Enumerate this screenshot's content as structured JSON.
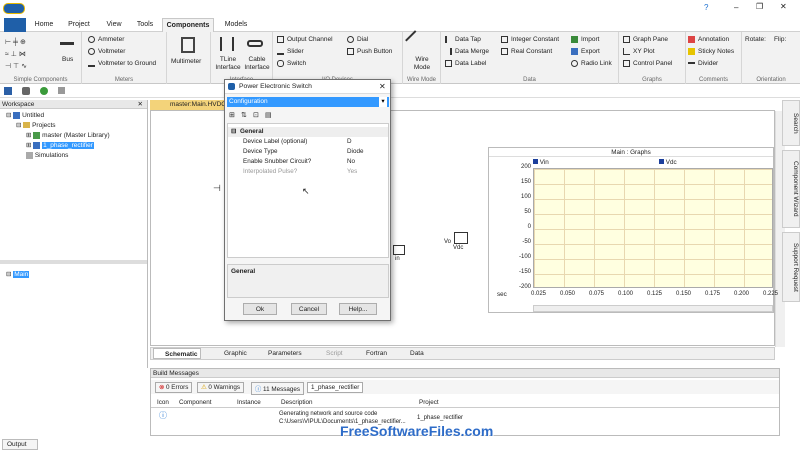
{
  "title_bar": {
    "minimize": "–",
    "maximize": "❐",
    "close": "✕",
    "help": "?"
  },
  "menu": [
    "Home",
    "Project",
    "View",
    "Tools",
    "Components",
    "Models"
  ],
  "ribbon": {
    "simple_components": {
      "label": "Simple Components",
      "bus": "Bus"
    },
    "meters": {
      "label": "Meters",
      "ammeter": "Ammeter",
      "voltmeter": "Voltmeter",
      "voltmeter_ground": "Voltmeter to Ground",
      "multimeter": "Multimeter"
    },
    "interface": {
      "label": "Interface",
      "tline": "TLine Interface",
      "cable": "Cable Interface"
    },
    "io": {
      "label": "I/O Devices",
      "output_channel": "Output Channel",
      "slider": "Slider",
      "switch": "Switch",
      "dial": "Dial",
      "push_button": "Push Button"
    },
    "wire_mode": {
      "label": "Wire Mode",
      "text": "Wire Mode"
    },
    "data": {
      "label": "Data",
      "data_tap": "Data Tap",
      "data_merge": "Data Merge",
      "data_label": "Data Label",
      "integer_constant": "Integer Constant",
      "real_constant": "Real Constant",
      "import": "Import",
      "export": "Export",
      "radio_link": "Radio Link"
    },
    "graphs": {
      "label": "Graphs",
      "graph_pane": "Graph Pane",
      "xy_plot": "XY Plot",
      "control_panel": "Control Panel"
    },
    "comments": {
      "label": "Comments",
      "annotation": "Annotation",
      "sticky_notes": "Sticky Notes",
      "divider": "Divider"
    },
    "orientation": {
      "label": "Orientation",
      "rotate": "Rotate:",
      "flip": "Flip:"
    }
  },
  "workspace": {
    "title": "Workspace",
    "tree": {
      "untitled": "Untitled",
      "projects": "Projects",
      "master": "master (Master Library)",
      "rectifier": "1_phase_rectifier",
      "simulations": "Simulations"
    },
    "main": "Main"
  },
  "doc_tab": "master:Main.HVDC",
  "graph": {
    "title": "Main : Graphs",
    "legend1": "Vin",
    "legend2": "Vdc",
    "yticks": [
      "200",
      "150",
      "100",
      "50",
      "0",
      "-50",
      "-100",
      "-150",
      "-200"
    ],
    "xlabel": "sec",
    "xticks": [
      "0.025",
      "0.050",
      "0.075",
      "0.100",
      "0.125",
      "0.150",
      "0.175",
      "0.200",
      "0.225"
    ]
  },
  "canvas_labels": {
    "vo": "Vo",
    "vdc": "Vdc",
    "in": "in"
  },
  "bottom_tabs": [
    "Schematic",
    "Graphic",
    "Parameters",
    "Script",
    "Fortran",
    "Data"
  ],
  "dialog": {
    "title": "Power Electronic Switch",
    "dropdown": "Configuration",
    "section": "General",
    "rows": [
      {
        "k": "Device Label (optional)",
        "v": "D"
      },
      {
        "k": "Device Type",
        "v": "Diode"
      },
      {
        "k": "Enable Snubber Circuit?",
        "v": "No"
      },
      {
        "k": "Interpolated Pulse?",
        "v": "Yes"
      }
    ],
    "description": "General",
    "ok": "Ok",
    "cancel": "Cancel",
    "help": "Help..."
  },
  "side_tabs": [
    "Search",
    "Component Wizard",
    "Support Request"
  ],
  "build": {
    "title": "Build Messages",
    "errors": "0 Errors",
    "warnings": "0 Warnings",
    "messages": "11 Messages",
    "project_filter": "1_phase_rectifier",
    "columns": [
      "Icon",
      "Component",
      "Instance",
      "Description",
      "Project"
    ],
    "row": {
      "desc1": "Generating network and source code",
      "desc2": "C:\\Users\\VIPUL\\Documents\\1_phase_rectifier...",
      "project": "1_phase_rectifier"
    }
  },
  "output_tab": "Output",
  "watermark": "FreeSoftwareFiles.com"
}
